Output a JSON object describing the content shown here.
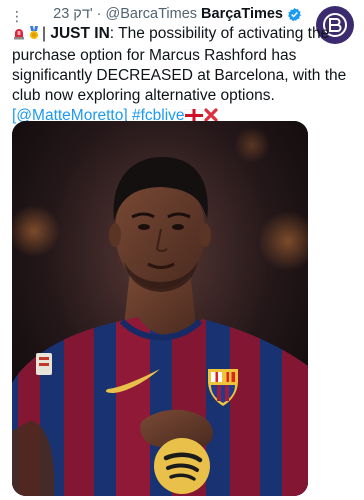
{
  "header": {
    "timestamp": "23 דק'",
    "separator": "·",
    "handle": "@BarcaTimes",
    "display_name": "BarçaTimes",
    "more_icon": "more-vertical-icon",
    "verified_icon": "verified-badge-icon",
    "avatar_icon": "barcatimes-logo-icon"
  },
  "tweet": {
    "emojis_lead": [
      "siren-emoji",
      "medal-emoji"
    ],
    "prefix": "| ",
    "breaking_label": "JUST IN",
    "body": ": The possibility of activating the purchase option for Marcus Rashford has significantly DECREASED at Barcelona, with the club now exploring alternative options.",
    "mention": "[@MatteMoretto]",
    "hashtag": "#fcblive",
    "emojis_trail": [
      "england-flag-emoji",
      "cross-mark-emoji"
    ]
  },
  "media": {
    "image_icon": "player-photo"
  },
  "colors": {
    "link": "#1d9bf0",
    "muted": "#536471",
    "verified": "#1d9bf0",
    "avatar_bg": "#3b2a6e",
    "shirt_blue": "#1f3d8c",
    "shirt_red": "#a01c3e"
  }
}
